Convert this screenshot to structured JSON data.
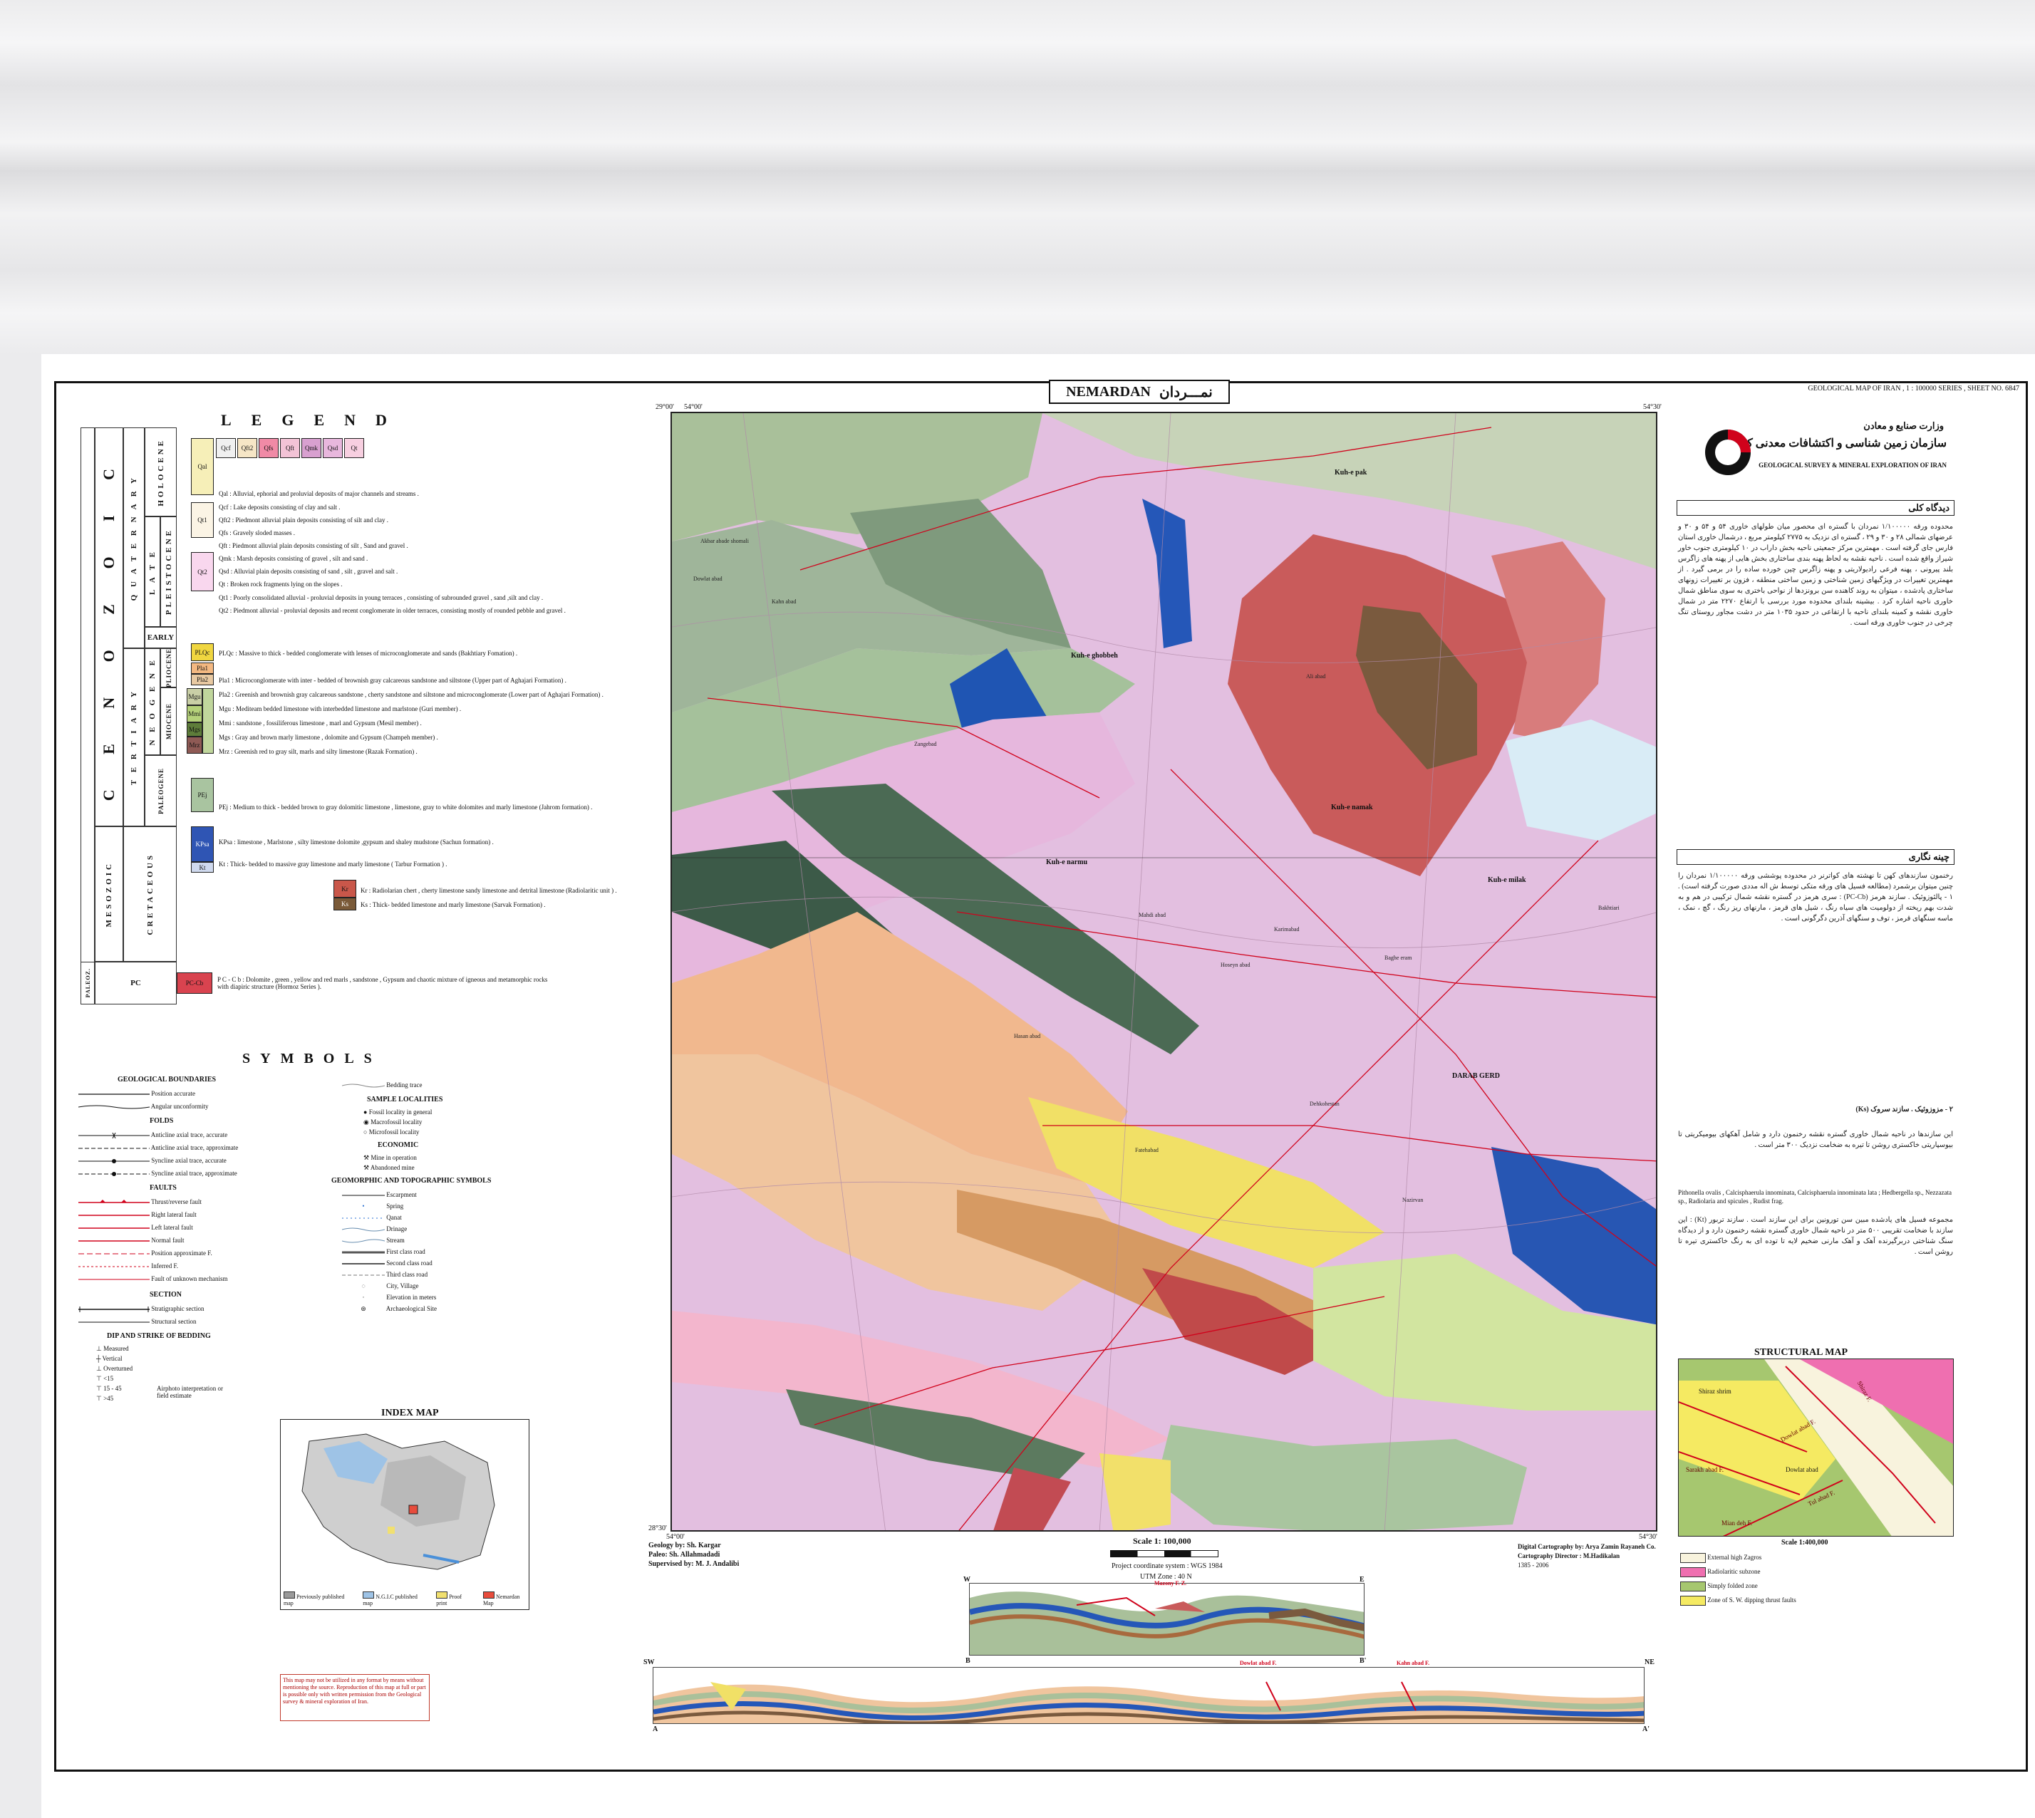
{
  "header": {
    "title_en": "NEMARDAN",
    "title_fa": "نمـــردان",
    "series": "GEOLOGICAL MAP OF IRAN , 1 : 100000 SERIES , SHEET NO. 6847"
  },
  "legend": {
    "title": "LEGEND",
    "eras": {
      "cenozoic": "C E N O Z O I C",
      "quaternary": "Q U A T E R N A R Y",
      "tertiary": "T E R T I A R Y",
      "holocene": "HOLOCENE",
      "pleistocene_late": "L A T E",
      "pleistocene": "PLEISTOCENE",
      "early": "EARLY",
      "neogene": "N E O G E N E",
      "pliocene": "PLIOCENE",
      "miocene": "MIOCENE",
      "paleogene": "PALEOGENE",
      "mesozoic": "MESOZOIC",
      "cretaceous": "CRETACEOUS",
      "paleozoic": "PALEOZ.",
      "pc": "PC"
    },
    "units": [
      {
        "code": "Qal",
        "desc": "Qal : Alluvial, ephorial and proluvial deposits of major channels and streams ."
      },
      {
        "code": "Qcf",
        "desc": "Qcf : Lake deposits consisting of clay and salt ."
      },
      {
        "code": "Qft2",
        "desc": "Qft2 : Piedmont alluvial plain deposits consisting of silt and clay ."
      },
      {
        "code": "Qfs",
        "desc": "Qfs : Gravely sloded masses ."
      },
      {
        "code": "Qft",
        "desc": "Qft : Piedmont alluvial plain deposits consisting of silt , Sand and gravel ."
      },
      {
        "code": "Qmk",
        "desc": "Qmk : Marsh deposits consisting of gravel , silt and sand ."
      },
      {
        "code": "Qsd",
        "desc": "Qsd : Alluvial plain deposits consisting of sand , silt , gravel and salt ."
      },
      {
        "code": "Qt",
        "desc": "Qt : Broken rock fragments lying on the slopes ."
      },
      {
        "code": "Qt1",
        "desc": "Qt1 : Poorly consolidated alluvial - proluvial deposits in young terraces , consisting of subrounded gravel , sand ,silt and clay ."
      },
      {
        "code": "Qt2",
        "desc": "Qt2 : Piedmont alluvial - proluvial deposits and recent conglomerate in older terraces, consisting mostly of rounded pebble and gravel ."
      },
      {
        "code": "PLQc",
        "desc": "PLQc : Massive to thick - bedded conglomerate with lenses of microconglomerate and sands (Bakhtiary Fomation) ."
      },
      {
        "code": "Pla1",
        "desc": "Pla1 : Microconglomerate with inter - bedded of brownish gray calcareous sandstone and siltstone (Upper part of Aghajari Formation) ."
      },
      {
        "code": "Pla2",
        "desc": "Pla2 : Greenish and brownish gray calcareous sandstone , cherty sandstone and siltstone and microconglomerate (Lower part of Aghajari Formation) ."
      },
      {
        "code": "Mgu",
        "desc": "Mgu : Mediteam bedded limestone with interbedded limestone and marlstone (Guri member) ."
      },
      {
        "code": "Mmi",
        "desc": "Mmi : sandstone , fossiliferous limestone , marl and Gypsum (Mesil member) ."
      },
      {
        "code": "Mgs",
        "desc": "Mgs : Gray and brown marly limestone , dolomite and Gypsum (Champeh member) ."
      },
      {
        "code": "Mrz",
        "desc": "Mrz : Greenish red to gray silt, marls and silty limestone (Razak Formation) ."
      },
      {
        "code": "PEj",
        "desc": "PEj : Medium to thick - bedded brown to gray dolomitic limestone , limestone, gray to white dolomites and marly limestone (Jahrom formation) ."
      },
      {
        "code": "KPsa",
        "desc": "KPsa : limestone , Marlstone , silty limestone dolomite ,gypsum and shaley mudstone (Sachun formation) ."
      },
      {
        "code": "Kt",
        "desc": "Kt : Thick- bedded to massive gray limestone and marly limestone ( Tarbur Formation ) ."
      },
      {
        "code": "Kr",
        "desc": "Kr : Radiolarian chert , cherty limestone sandy limestone and detrital limestone (Radiolaritic unit ) ."
      },
      {
        "code": "Ks",
        "desc": "Ks : Thick- bedded limestone and marly limestone (Sarvak Formation) ."
      },
      {
        "code": "PC-Cb",
        "desc": "P C - C b : Dolomite , green , yellow and red marls , sandstone , Gypsum and chaotic mixture of igneous and metamorphic rocks with diapiric structure (Hormoz Series )."
      }
    ]
  },
  "symbols": {
    "title": "SYMBOLS",
    "groups": [
      {
        "head": "GEOLOGICAL BOUNDARIES",
        "items": [
          "Position accurate",
          "Angular unconformity"
        ]
      },
      {
        "head": "FOLDS",
        "items": [
          "Anticline axial trace, accurate",
          "Anticline axial trace, approximate",
          "Syncline axial trace, accurate",
          "Syncline axial trace, approximate"
        ]
      },
      {
        "head": "FAULTS",
        "items": [
          "Thrust/reverse fault",
          "Right lateral fault",
          "Left lateral fault",
          "Normal fault",
          "Position approximate F.",
          "Inferred F.",
          "Fault of unknown mechanism"
        ]
      },
      {
        "head": "SECTION",
        "items": [
          "Stratigraphic section",
          "Structural section"
        ]
      },
      {
        "head": "DIP AND STRIKE OF BEDDING",
        "items": [
          "Measured",
          "Vertical",
          "Overturned",
          "<15",
          "15 - 45",
          ">45",
          "Airphoto interpretation or field estimate"
        ]
      }
    ],
    "groups_right": [
      {
        "head": "",
        "items": [
          "Bedding trace"
        ]
      },
      {
        "head": "SAMPLE LOCALITIES",
        "items": [
          "Fossil locality in general",
          "Macrofossil locality",
          "Microfossil locality"
        ]
      },
      {
        "head": "ECONOMIC",
        "items": [
          "Mine in operation",
          "Abandoned mine"
        ]
      },
      {
        "head": "GEOMORPHIC AND TOPOGRAPHIC SYMBOLS",
        "items": [
          "Escarpment",
          "Spring",
          "Qanat",
          "Drinage",
          "Stream",
          "First class road",
          "Second class road",
          "Third class road",
          "City, Village",
          "Elevation in meters",
          "Archaeological Site"
        ]
      }
    ]
  },
  "index_map": {
    "title": "INDEX MAP",
    "legend": [
      "Previously published map",
      "N.G.I.C published map",
      "Proof print",
      "Nemardan Map"
    ]
  },
  "warning": "This map may not be utilized in any format by means without mentioning the source. Reproduction of this map at full or part is possible only with written permission from the Geological survey & mineral exploration of Iran.",
  "map": {
    "coords": {
      "tl_lon": "54°00'",
      "tl_lat": "29°00'",
      "tr_lon": "54°30'",
      "bl_lat": "28°30'",
      "bl_lon": "54°00'",
      "br_lon": "54°30'"
    },
    "labels": [
      "Kuh-e pak",
      "Kuh-e ghobbeh",
      "Kuh-e namak",
      "Kuh-e narmu",
      "Kuh-e milak",
      "DARAB GERD",
      "Dowlat abad",
      "Akbar abade shomali",
      "Kahn abad",
      "Ali abad",
      "Zangebad",
      "Hasan abad",
      "Mahdi abad",
      "Hoseyn abad",
      "Baghe eram",
      "Fatehabad",
      "Bakhtiari",
      "Karimabad",
      "Dehkohestan",
      "Nazirvan"
    ]
  },
  "credits": {
    "left": [
      "Geology by: Sh. Kargar",
      "Paleo: Sh. Allahmadadi",
      "Supervised by: M. J. Andalibi"
    ],
    "scale": "Scale 1: 100,000",
    "projection": "Project coordinate system : WGS 1984",
    "utm": "UTM Zone : 40 N",
    "right": [
      "Digital Cartography by: Arya Zamin Rayaneh Co.",
      "Cartography Director : M.Hadikalan",
      "1385 - 2006"
    ]
  },
  "sections": {
    "be": {
      "left": "W",
      "right": "E",
      "bl": "B",
      "br": "B'",
      "fault": "Mazony F. Z."
    },
    "aa": {
      "left": "SW",
      "right": "NE",
      "bl": "A",
      "br": "A'",
      "fault1": "Dowlat abad F.",
      "fault2": "Kahn abad F."
    }
  },
  "right_panel": {
    "org_fa1": "وزارت صنایع و معادن",
    "org_fa2": "سازمان زمین شناسی و اکتشافات معدنی کشور",
    "org_en": "GEOLOGICAL SURVEY & MINERAL EXPLORATION OF IRAN",
    "overview_head": "دیدگاه کلی",
    "overview": "محدوده ورقه ۱/۱۰۰۰۰۰ نمردان با گستره ای محصور میان طولهای خاوری ۵۴ و ۵۴ و ۳۰ و عرضهای شمالی ۲۸ و ۳۰ و ۲۹ ، گستره ای نزدیک به ۲۷۷۵ کیلومتر مربع ، درشمال خاوری استان فارس جای گرفته است . مهمترین مرکز جمعیتی ناحیه بخش داراب در ۱۰ کیلومتری جنوب خاور شیراز واقع شده است . ناحیه نقشه به لحاظ پهنه بندی ساختاری بخش هایی از پهنه های زاگرس بلند پیرونی ، پهنه فرعی رادیولاریتی و پهنه زاگرس چین خورده ساده را در برمی گیرد . از مهمترین تغییرات در ویژگیهای زمین شناختی و زمین ساختی منطقه ، فزون بر تغییرات زونهای ساختاری پادشده ، میتوان به روند کاهنده سن برونزدها از نواحی باختری به سوی مناطق شمال خاوری ناحیه اشاره کرد . بیشینه بلندای محدوده مورد بررسی با ارتفاع ۲۲۷۰ متر در شمال خاوری نقشه و کمینه بلندای ناحیه با ارتفاعی در حدود ۱۰۳۵ متر در دشت مجاور روستای تنگ چرخی در جنوب خاوری ورقه است .",
    "strat_head": "چینه نگاری",
    "strat": "رخنمون سازندهای کهن تا نهشته های کواترنر در محدوده پوششی ورقه ۱/۱۰۰۰۰۰ نمردان را چنین میتوان برشمرد (مطالعه فسیل های ورقه متکی توسط ش اله مددی صورت گرفته است) . ۱ - پالئوزوئیک . سازند هرمز (PC-Cb) : سری هرمز در گستره نقشه شمال ترکیبی در هم و به شدت بهم ریخته از دولومیت های سیاه رنگ ، شیل های قرمز ، مارنهای ریز رنگ ، گچ ، نمک ، ماسه سنگهای قرمز ، توف و سنگهای آذرین دگرگونی است .",
    "meso_head": "۲ - مزوزوئیک . سازند سروک (Ks)",
    "meso": "این سازندها در ناحیه شمال خاوری گستره نقشه رخنمون دارد و شامل آهکهای بیومیکریتی تا بیوسپاریتی خاکستری روشن تا تیره به ضخامت نزدیک ۳۰۰ متر است .",
    "fossils": "Pithonella ovalis , Calcisphaerula innominata, Calcisphaerula innominata lata ; Hedbergella sp., Nezzazata sp., Radiolaria and spicules , Rudist frag.",
    "radiolarite": "مجموعه فسیل های یادشده مبین سن تورونین برای این سازند است . سازند تربور (Kt) : این سازند با ضخامت تقریبی ۵۰۰ متر در ناحیه شمال خاوری گستره نقشه رخنمون دارد و از دیدگاه سنگ شناختی دربرگیرنده آهک و آهک مارنی ضخیم لایه تا توده ای به رنگ خاکستری تیره تا روشن است .",
    "structural_map": {
      "title": "STRUCTURAL MAP",
      "scale": "Scale 1:400,000",
      "labels": [
        "Shiraz F.",
        "Dowlat abad F.",
        "Sarakh abad F.",
        "Tul abad F.",
        "Mian deh F.",
        "Shiraz shrim",
        "Dowlat abad"
      ],
      "key": [
        "External high Zagros",
        "Radiolaritic subzone",
        "Simply folded zone",
        "Zone of S. W. dipping thrust faults"
      ]
    }
  },
  "colors": {
    "kt": "#a8c7a0",
    "kpsa": "#2b54b0",
    "pej": "#93a88a",
    "mgs": "#bdbdbd",
    "pla": "#f1c08f",
    "plqc": "#f2e866",
    "qal": "#f3e6f0",
    "qt": "#e6b3dc",
    "pccb": "#c85a6a",
    "kr": "#c86a5a",
    "ks": "#5a4a2a",
    "dark": "#3f5a4a",
    "pink": "#f4a6c8"
  }
}
